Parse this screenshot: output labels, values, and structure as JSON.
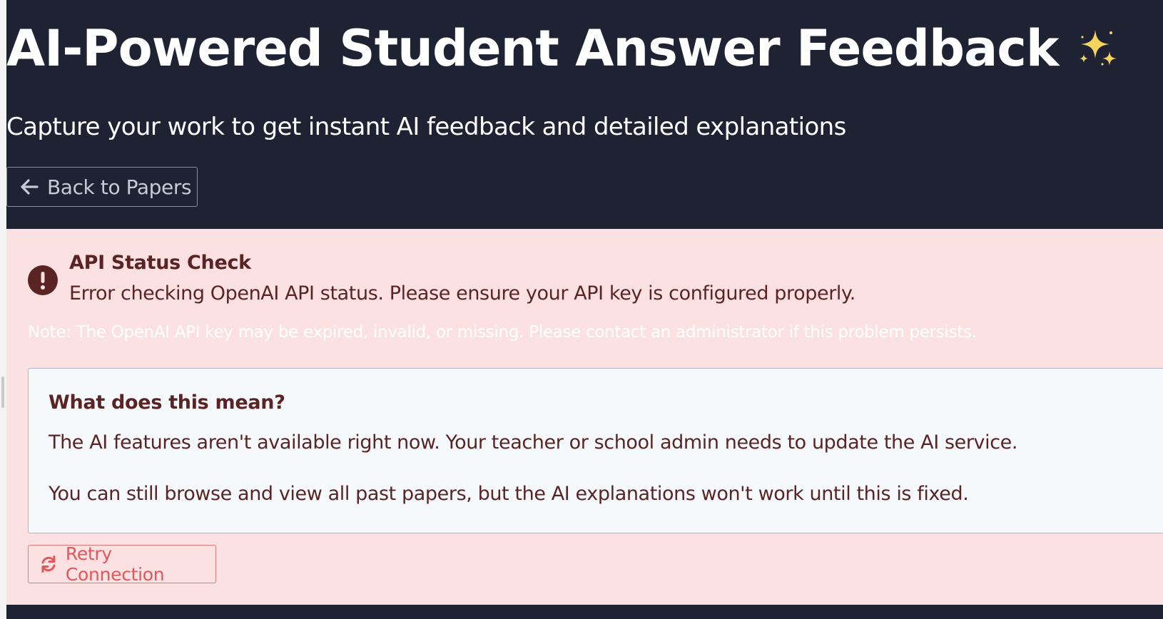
{
  "header": {
    "title": "AI-Powered Student Answer Feedback",
    "title_icon": "sparkles-icon",
    "subtitle": "Capture your work to get instant AI feedback and detailed explanations",
    "back_button": {
      "label": "Back to Papers",
      "icon": "arrow-left-icon"
    }
  },
  "alert": {
    "icon": "exclamation-circle-icon",
    "heading": "API Status Check",
    "message": "Error checking OpenAI API status. Please ensure your API key is configured properly.",
    "note": "Note: The OpenAI API key may be expired, invalid, or missing. Please contact an administrator if this problem persists.",
    "info": {
      "title": "What does this mean?",
      "paragraphs": [
        "The AI features aren't available right now. Your teacher or school admin needs to update the AI service.",
        "You can still browse and view all past papers, but the AI explanations won't work until this is fixed."
      ]
    },
    "retry_button": {
      "label": "Retry Connection",
      "icon": "refresh-icon"
    }
  },
  "colors": {
    "page_background": "#1e2233",
    "alert_background": "#fbe1e2",
    "alert_text": "#5a2424",
    "info_background": "#f5f9fb",
    "retry_accent": "#e0585c"
  }
}
